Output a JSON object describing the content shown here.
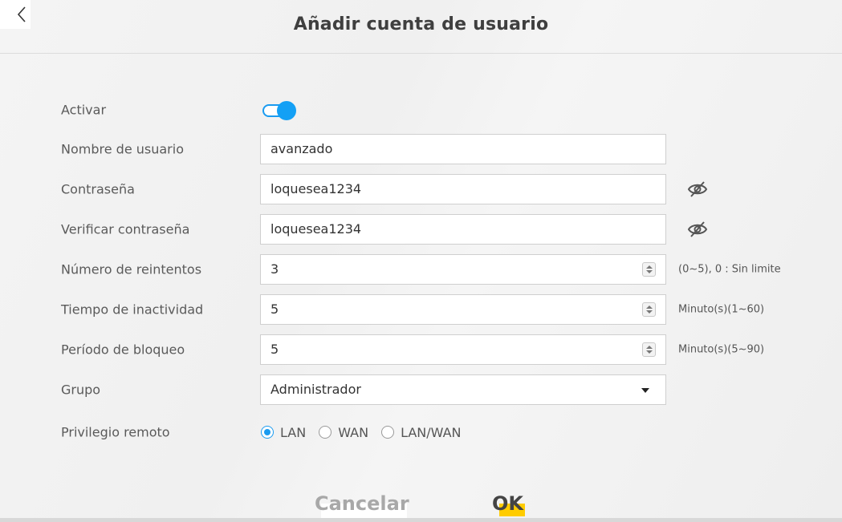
{
  "header": {
    "title": "Añadir cuenta de usuario"
  },
  "form": {
    "activate": {
      "label": "Activar",
      "enabled": true
    },
    "username": {
      "label": "Nombre de usuario",
      "value": "avanzado"
    },
    "password": {
      "label": "Contraseña",
      "value": "loquesea1234"
    },
    "verify_password": {
      "label": "Verificar contraseña",
      "value": "loquesea1234"
    },
    "retries": {
      "label": "Número de reintentos",
      "value": "3",
      "hint": "(0~5), 0 : Sin limite"
    },
    "idle_timeout": {
      "label": "Tiempo de inactividad",
      "value": "5",
      "hint": "Minuto(s)(1~60)"
    },
    "lockout": {
      "label": "Período de bloqueo",
      "value": "5",
      "hint": "Minuto(s)(5~90)"
    },
    "group": {
      "label": "Grupo",
      "value": "Administrador"
    },
    "remote_privilege": {
      "label": "Privilegio remoto",
      "options": [
        "LAN",
        "WAN",
        "LAN/WAN"
      ],
      "selected": "LAN"
    }
  },
  "buttons": {
    "cancel": "Cancelar",
    "ok": "OK"
  },
  "colors": {
    "accent": "#1a9bf0",
    "ok_highlight": "#ffcc00"
  },
  "icons": {
    "back": "chevron-left-icon",
    "eye": "eye-slash-icon"
  }
}
